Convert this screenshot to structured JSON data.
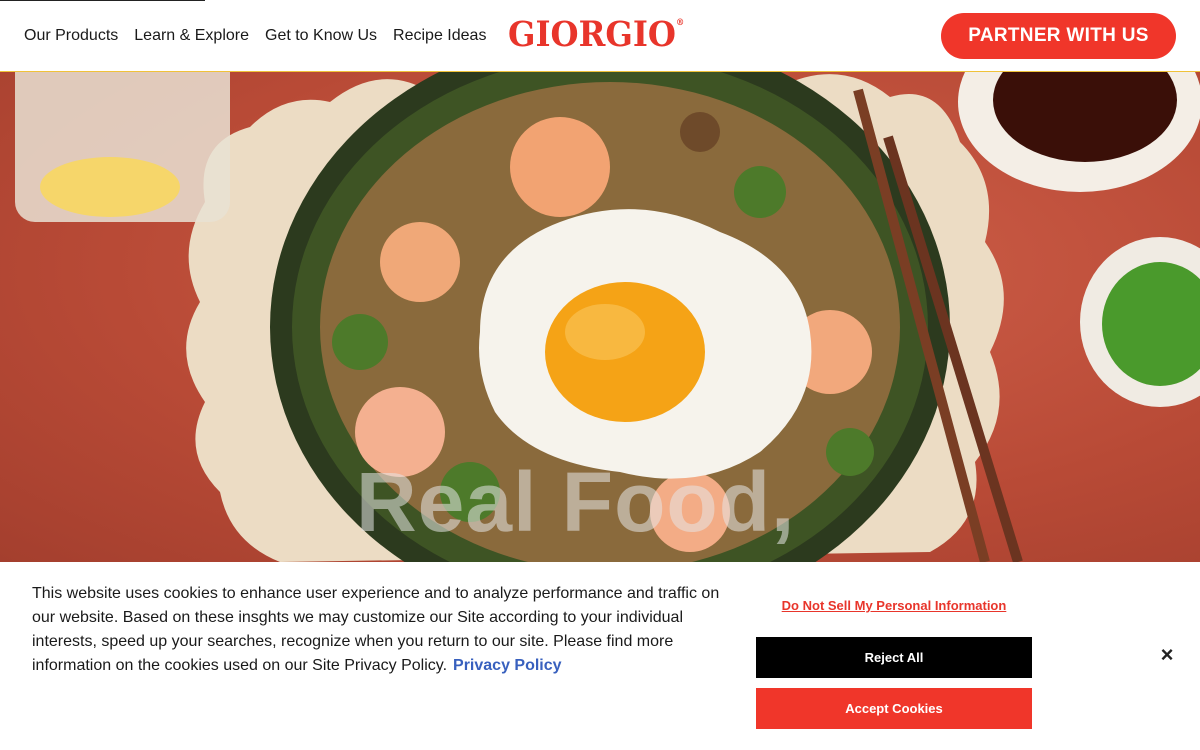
{
  "nav": {
    "items": [
      {
        "label": "Our Products"
      },
      {
        "label": "Learn & Explore"
      },
      {
        "label": "Get to Know Us"
      },
      {
        "label": "Recipe Ideas"
      }
    ],
    "logo_text": "GIORGIO",
    "logo_mark": "®",
    "partner_label": "PARTNER WITH US"
  },
  "hero": {
    "title_line1": "Real Food,",
    "image_icon": "rice-bowl-with-fried-egg-and-shrimp"
  },
  "cookie_banner": {
    "text": "This website uses cookies to enhance user experience and to analyze performance and traffic on our website. Based on these insghts we may customize our Site according to your individual interests, speed up your searches, recognize when you return to our site. Please find more information on the cookies used on our Site Privacy Policy.",
    "privacy_link": "Privacy Policy",
    "do_not_sell": "Do Not Sell My Personal Information",
    "reject_label": "Reject All",
    "accept_label": "Accept Cookies",
    "close_label": "×"
  },
  "colors": {
    "brand_red": "#f0362a",
    "header_border": "#f0c23a",
    "link_blue": "#3860be"
  }
}
